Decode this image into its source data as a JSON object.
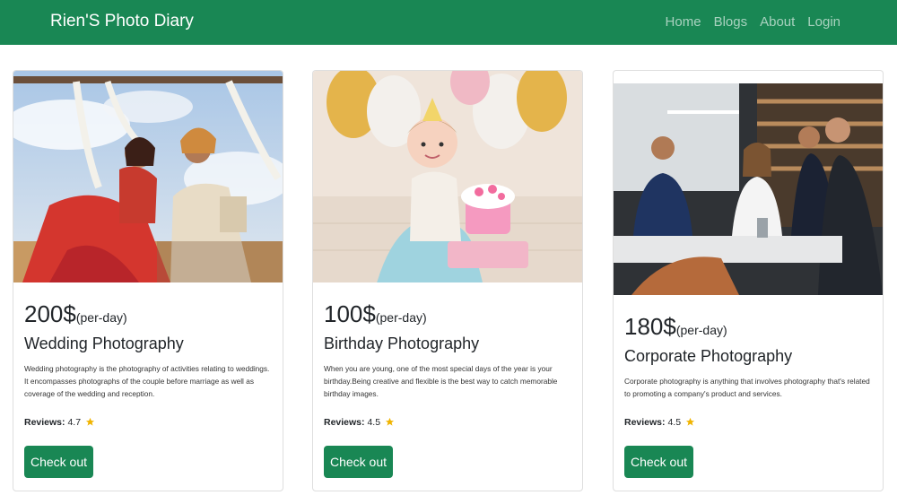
{
  "navbar": {
    "brand": "Rien'S Photo Diary",
    "links": [
      "Home",
      "Blogs",
      "About",
      "Login"
    ]
  },
  "cards": [
    {
      "image_alt": "wedding couple photo",
      "price": "200$",
      "per": "(per-day)",
      "title": "Wedding Photography",
      "description": "Wedding photography is the photography of activities relating to weddings. It encompasses photographs of the couple before marriage as well as coverage of the wedding and reception.",
      "reviews_label": "Reviews:",
      "rating": "4.7",
      "button": "Check out"
    },
    {
      "image_alt": "baby birthday photo",
      "price": "100$",
      "per": "(per-day)",
      "title": "Birthday Photography",
      "description": "When you are young, one of the most special days of the year is your birthday.Being creative and flexible is the best way to catch memorable birthday images.",
      "reviews_label": "Reviews:",
      "rating": "4.5",
      "button": "Check out"
    },
    {
      "image_alt": "corporate meeting photo",
      "price": "180$",
      "per": "(per-day)",
      "title": "Corporate Photography",
      "description": "Corporate photography is anything that involves photography that's related to promoting a company's product and services.",
      "reviews_label": "Reviews:",
      "rating": "4.5",
      "button": "Check out"
    }
  ],
  "colors": {
    "primary": "#198754",
    "star": "#f0b400"
  }
}
